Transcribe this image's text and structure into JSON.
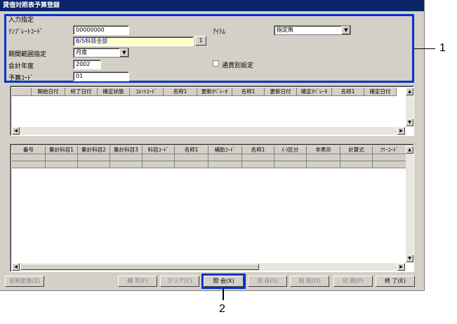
{
  "window": {
    "title": "貸借対照表予算登録"
  },
  "input": {
    "group_label": "入力指定",
    "template_code_label": "ﾃﾝﾌﾟﾚｰﾄｺｰﾄﾞ",
    "template_code_value": "00000000",
    "template_name_value": "B/S科目全部",
    "lookup_button": "1",
    "item_label": "ｱｲﾃﾑ",
    "item_value": "指定無",
    "period_label": "期間範囲指定",
    "period_value": "月度",
    "fiscal_year_label": "会計年度",
    "fiscal_year_value": "2002",
    "budget_code_label": "予算ｺｰﾄﾞ",
    "budget_code_value": "01",
    "currency_label": "通貨別設定"
  },
  "grid1": {
    "headers": [
      "",
      "開始日付",
      "終了日付",
      "確定状態",
      "ｺﾒﾝﾄｺｰﾄﾞ",
      "名称1",
      "更新ｵﾍﾟﾚｰﾀ",
      "名称1",
      "更新日付",
      "確定ｵﾍﾟﾚｰﾀ",
      "名称1",
      "確定日付"
    ]
  },
  "grid2": {
    "headers": [
      "番号",
      "集計科目1",
      "集計科目2",
      "集計科目3",
      "科目ｺｰﾄﾞ",
      "名称1",
      "補助ｺｰﾄﾞ",
      "名称1",
      "(-)区分",
      "非表示",
      "計算式",
      "ﾌﾘｰｺｰﾄﾞ"
    ]
  },
  "footer": {
    "rename": "名称変換(Z)",
    "fill": "補 写(F)",
    "clear": "クリア(C)",
    "inquiry": "照 会(X)",
    "save": "保 存(S)",
    "delete": "削 除(D)",
    "print": "印 刷(P)",
    "exit": "終 了(E)"
  },
  "callouts": {
    "one": "1",
    "two": "2"
  }
}
